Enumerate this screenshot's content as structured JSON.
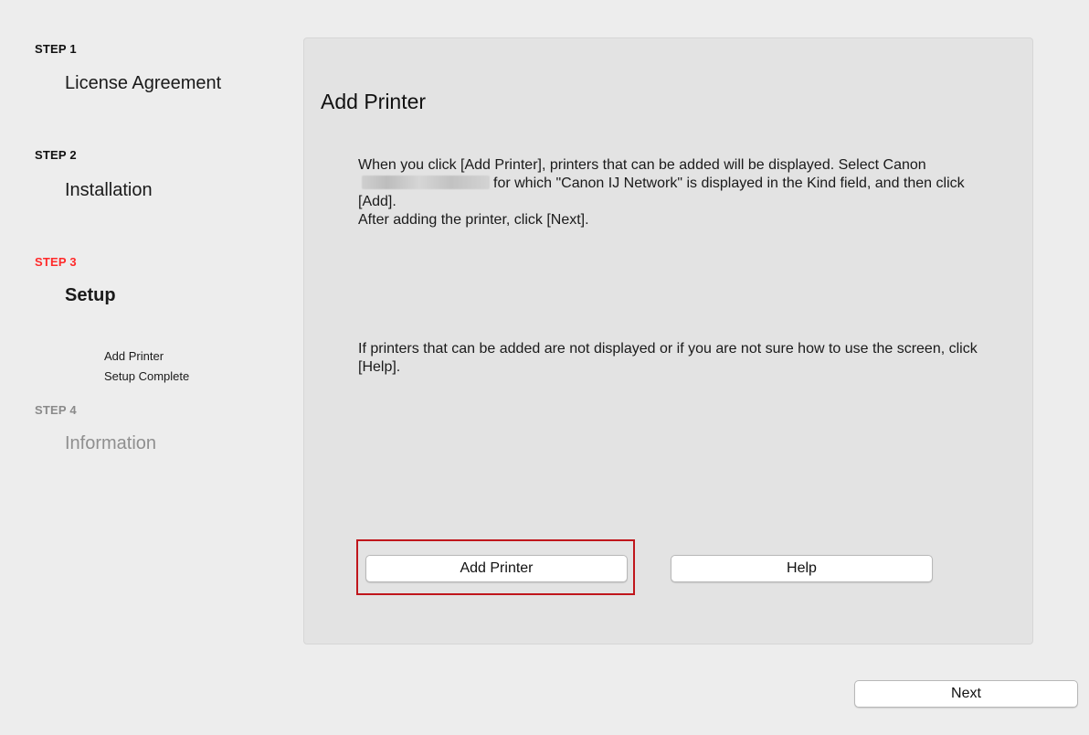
{
  "sidebar": {
    "steps": [
      {
        "label": "STEP 1",
        "title": "License Agreement",
        "state": "done"
      },
      {
        "label": "STEP 2",
        "title": "Installation",
        "state": "done"
      },
      {
        "label": "STEP 3",
        "title": "Setup",
        "state": "active",
        "substeps": [
          "Add Printer",
          "Setup Complete"
        ]
      },
      {
        "label": "STEP 4",
        "title": "Information",
        "state": "pending"
      }
    ]
  },
  "panel": {
    "title": "Add Printer",
    "paragraph1": {
      "part1": "When you click [Add Printer], printers that can be added will be displayed. Select Canon",
      "part2": "for which \"Canon IJ Network\" is displayed in the Kind field, and then click [Add].",
      "line4": "After adding the printer, click [Next]."
    },
    "paragraph2": "If printers that can be added are not displayed or if you are not sure how to use the screen, click [Help].",
    "add_printer_button": "Add Printer",
    "help_button": "Help"
  },
  "footer": {
    "next_button": "Next"
  },
  "colors": {
    "active_step": "#ff2a2a",
    "highlight_border": "#c0161c",
    "panel_bg": "#e3e3e3",
    "window_bg": "#ededed"
  }
}
